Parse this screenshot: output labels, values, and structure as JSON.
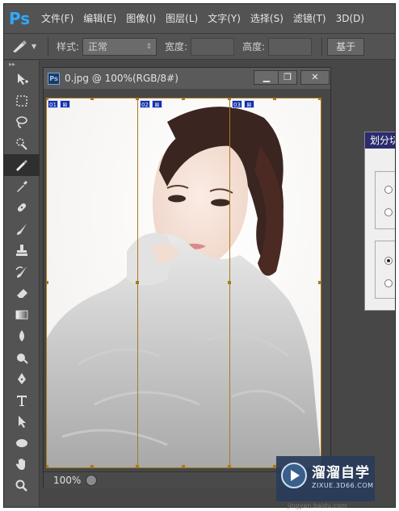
{
  "app": {
    "logo": "Ps"
  },
  "menu": [
    "文件(F)",
    "编辑(E)",
    "图像(I)",
    "图层(L)",
    "文字(Y)",
    "选择(S)",
    "滤镜(T)",
    "3D(D)"
  ],
  "options": {
    "style_label": "样式:",
    "style_value": "正常",
    "width_label": "宽度:",
    "height_label": "高度:",
    "slices_button": "基于"
  },
  "toolbar": {
    "grip": "▸▸",
    "tools": [
      "move-icon",
      "marquee-icon",
      "lasso-icon",
      "quick-select-icon",
      "slice-icon",
      "eyedropper-icon",
      "healing-brush-icon",
      "brush-icon",
      "clone-stamp-icon",
      "history-brush-icon",
      "eraser-icon",
      "gradient-icon",
      "blur-icon",
      "dodge-icon",
      "pen-icon",
      "type-icon",
      "path-select-icon",
      "ellipse-icon",
      "hand-icon",
      "zoom-icon"
    ],
    "active_index": 4
  },
  "document": {
    "title": "0.jpg @ 100%(RGB/8#)",
    "ps_badge": "Ps",
    "min": "▁",
    "max": "❐",
    "close": "✕",
    "zoom": "100%",
    "slices": [
      {
        "num": "01",
        "badge": "⊠"
      },
      {
        "num": "02",
        "badge": "⊠"
      },
      {
        "num": "03",
        "badge": "⊠"
      }
    ]
  },
  "dialog": {
    "title": "划分切片"
  },
  "watermark": {
    "title": "溜溜自学",
    "sub": "ZIXUE.3D66.COM",
    "url": "jingyan.baidu.com"
  },
  "colors": {
    "accent": "#31a8ff",
    "slice_line": "#a97a1a",
    "slice_tag": "#1230a6"
  }
}
